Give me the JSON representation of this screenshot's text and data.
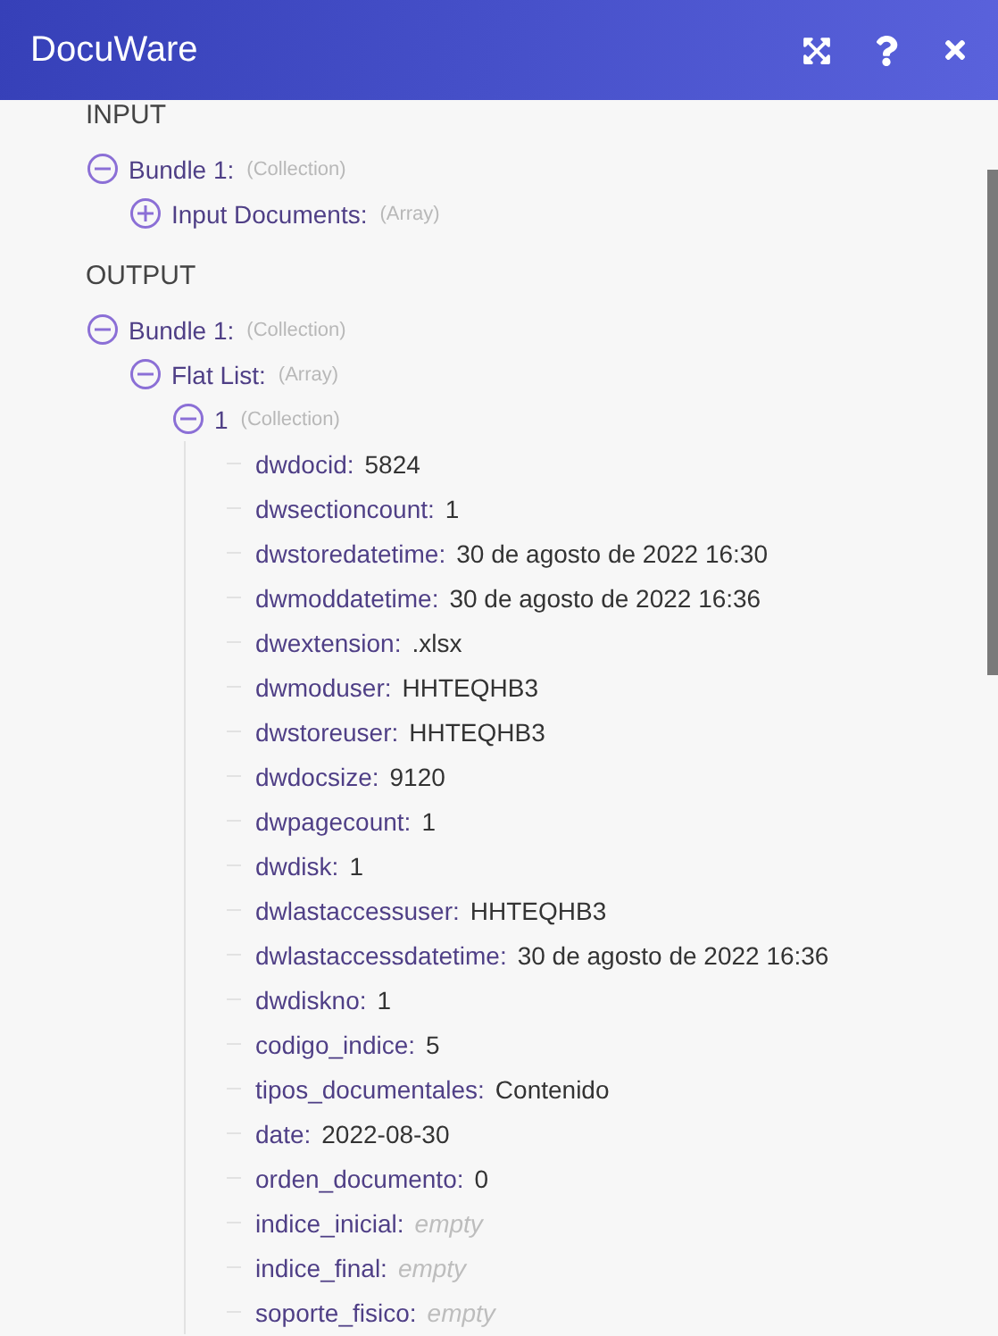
{
  "window": {
    "title": "DocuWare"
  },
  "sections": [
    {
      "title": "INPUT",
      "items": [
        {
          "kind": "node",
          "label": "Bundle 1:",
          "type": "(Collection)",
          "expanded": true,
          "children": [
            {
              "kind": "node",
              "label": "Input Documents:",
              "type": "(Array)",
              "expanded": false
            }
          ]
        }
      ]
    },
    {
      "title": "OUTPUT",
      "items": [
        {
          "kind": "node",
          "label": "Bundle 1:",
          "type": "(Collection)",
          "expanded": true,
          "children": [
            {
              "kind": "node",
              "label": "Flat List:",
              "type": "(Array)",
              "expanded": true,
              "children": [
                {
                  "kind": "node",
                  "label": "1",
                  "type": "(Collection)",
                  "expanded": true,
                  "children": [
                    {
                      "kind": "field",
                      "label": "dwdocid:",
                      "value": "5824"
                    },
                    {
                      "kind": "field",
                      "label": "dwsectioncount:",
                      "value": "1"
                    },
                    {
                      "kind": "field",
                      "label": "dwstoredatetime:",
                      "value": "30 de agosto de 2022 16:30"
                    },
                    {
                      "kind": "field",
                      "label": "dwmoddatetime:",
                      "value": "30 de agosto de 2022 16:36"
                    },
                    {
                      "kind": "field",
                      "label": "dwextension:",
                      "value": ".xlsx"
                    },
                    {
                      "kind": "field",
                      "label": "dwmoduser:",
                      "value": "HHTEQHB3"
                    },
                    {
                      "kind": "field",
                      "label": "dwstoreuser:",
                      "value": "HHTEQHB3"
                    },
                    {
                      "kind": "field",
                      "label": "dwdocsize:",
                      "value": "9120"
                    },
                    {
                      "kind": "field",
                      "label": "dwpagecount:",
                      "value": "1"
                    },
                    {
                      "kind": "field",
                      "label": "dwdisk:",
                      "value": "1"
                    },
                    {
                      "kind": "field",
                      "label": "dwlastaccessuser:",
                      "value": "HHTEQHB3"
                    },
                    {
                      "kind": "field",
                      "label": "dwlastaccessdatetime:",
                      "value": "30 de agosto de 2022 16:36"
                    },
                    {
                      "kind": "field",
                      "label": "dwdiskno:",
                      "value": "1"
                    },
                    {
                      "kind": "field",
                      "label": "codigo_indice:",
                      "value": "5"
                    },
                    {
                      "kind": "field",
                      "label": "tipos_documentales:",
                      "value": "Contenido"
                    },
                    {
                      "kind": "field",
                      "label": "date:",
                      "value": "2022-08-30"
                    },
                    {
                      "kind": "field",
                      "label": "orden_documento:",
                      "value": "0"
                    },
                    {
                      "kind": "empty",
                      "label": "indice_inicial:",
                      "value": "empty"
                    },
                    {
                      "kind": "empty",
                      "label": "indice_final:",
                      "value": "empty"
                    },
                    {
                      "kind": "empty",
                      "label": "soporte_fisico:",
                      "value": "empty"
                    }
                  ]
                }
              ]
            }
          ]
        }
      ]
    }
  ]
}
